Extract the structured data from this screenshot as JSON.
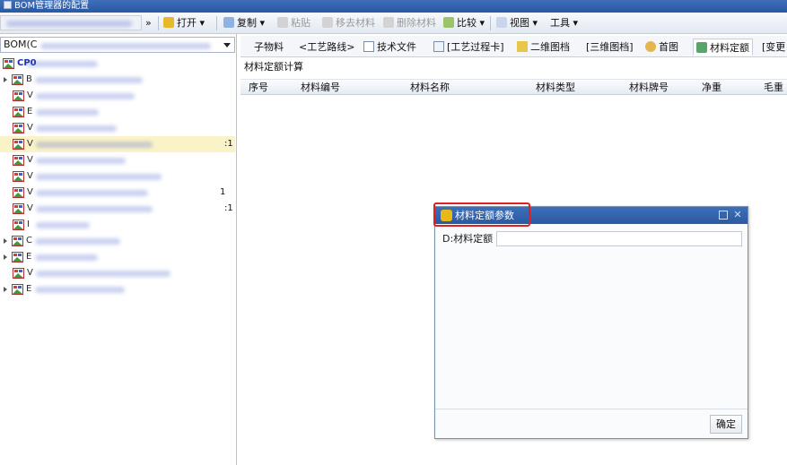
{
  "window": {
    "title": "BOM管理器的配置"
  },
  "toolbar": {
    "open_label": "打开",
    "copy_label": "复制",
    "paste_label": "粘贴",
    "move_label": "移去材料",
    "delete_label": "删除材料",
    "compare_label": "比较",
    "view_label": "视图",
    "tools_label": "工具"
  },
  "left_panel": {
    "bom_select_value": "BOM(C",
    "tree": [
      {
        "text": "CP0",
        "suffix": "",
        "expandable": false,
        "level": 0,
        "selected": false
      },
      {
        "text": "B",
        "suffix": "",
        "expandable": true,
        "level": 0,
        "selected": false
      },
      {
        "text": "V",
        "suffix": "",
        "expandable": false,
        "level": 1,
        "selected": false
      },
      {
        "text": "E",
        "suffix": "",
        "expandable": false,
        "level": 1,
        "selected": false
      },
      {
        "text": "V",
        "suffix": "",
        "expandable": false,
        "level": 1,
        "selected": false
      },
      {
        "text": "V",
        "suffix": ":1",
        "expandable": false,
        "level": 1,
        "selected": true
      },
      {
        "text": "V",
        "suffix": "",
        "expandable": false,
        "level": 1,
        "selected": false
      },
      {
        "text": "V",
        "suffix": "",
        "expandable": false,
        "level": 1,
        "selected": false
      },
      {
        "text": "V",
        "suffix": "1",
        "expandable": false,
        "level": 1,
        "selected": false
      },
      {
        "text": "V",
        "suffix": ":1",
        "expandable": false,
        "level": 1,
        "selected": false
      },
      {
        "text": "I",
        "suffix": "",
        "expandable": false,
        "level": 1,
        "selected": false
      },
      {
        "text": "C",
        "suffix": "",
        "expandable": true,
        "level": 0,
        "selected": false
      },
      {
        "text": "E",
        "suffix": "",
        "expandable": true,
        "level": 0,
        "selected": false
      },
      {
        "text": "V",
        "suffix": "",
        "expandable": false,
        "level": 1,
        "selected": false
      },
      {
        "text": "E",
        "suffix": "",
        "expandable": true,
        "level": 0,
        "selected": false
      }
    ]
  },
  "tabs": [
    {
      "label": "子物料",
      "icon": "",
      "active": false
    },
    {
      "label": "<工艺路线>",
      "icon": "",
      "active": false
    },
    {
      "label": "技术文件",
      "icon": "document-icon",
      "active": false
    },
    {
      "label": "[工艺过程卡]",
      "icon": "process-card-icon",
      "active": false
    },
    {
      "label": "二维图档",
      "icon": "drawing-2d-icon",
      "active": false
    },
    {
      "label": "[三维图档]",
      "icon": "",
      "active": false
    },
    {
      "label": "首图",
      "icon": "first-image-icon",
      "active": false
    },
    {
      "label": "材料定额",
      "icon": "material-quota-icon",
      "active": true
    },
    {
      "label": "[变更",
      "icon": "",
      "active": false
    }
  ],
  "main": {
    "section_title": "材料定额计算",
    "columns": [
      "序号",
      "材料编号",
      "材料名称",
      "材料类型",
      "材料牌号",
      "净重",
      "毛重"
    ]
  },
  "dialog": {
    "title": "材料定额参数",
    "field_label": "D:材料定额",
    "field_value": "",
    "ok_label": "确定",
    "highlight_color": "#e02020"
  },
  "colors": {
    "title_bar": "#2a58a3",
    "selected_row": "#fbf3c8",
    "tree_root_text": "#1a2fb0"
  }
}
